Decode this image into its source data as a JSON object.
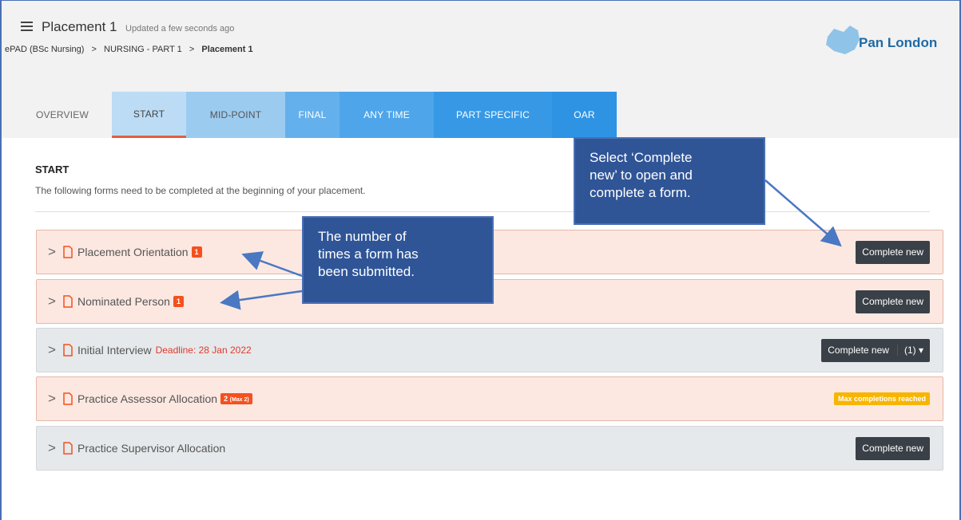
{
  "header": {
    "title": "Placement 1",
    "updated": "Updated a few seconds ago",
    "breadcrumb": [
      "ePAD (BSc Nursing)",
      ">",
      "NURSING - PART 1",
      ">",
      "Placement 1"
    ],
    "logo_text": "Pan London"
  },
  "tabs": [
    "OVERVIEW",
    "START",
    "MID-POINT",
    "FINAL",
    "ANY TIME",
    "PART SPECIFIC",
    "OAR"
  ],
  "section": {
    "title": "START",
    "description": "The following forms need to be completed at the beginning of your placement."
  },
  "rows": [
    {
      "label": "Placement Orientation",
      "badge": "1",
      "action": "Complete new"
    },
    {
      "label": "Nominated Person",
      "badge": "1",
      "action": "Complete new"
    },
    {
      "label": "Initial Interview",
      "deadline": "Deadline: 28 Jan 2022",
      "action": "Complete new",
      "count": "(1)"
    },
    {
      "label": "Practice Assessor Allocation",
      "badge": "2",
      "badge_max": "(Max 2)",
      "status": "Max completions reached"
    },
    {
      "label": "Practice Supervisor Allocation",
      "action": "Complete new"
    }
  ],
  "callouts": {
    "submitted": [
      "The number of",
      "times a form has",
      "been submitted."
    ],
    "complete_new": [
      "Select ‘Complete",
      "new’ to open and",
      "complete a form."
    ]
  },
  "colors": {
    "accent_orange": "#f4511e",
    "callout_blue": "#2f5597",
    "max_yellow": "#f7b500"
  },
  "icons": [
    "menu-icon",
    "chevron-right-icon",
    "document-icon",
    "caret-down-icon"
  ]
}
